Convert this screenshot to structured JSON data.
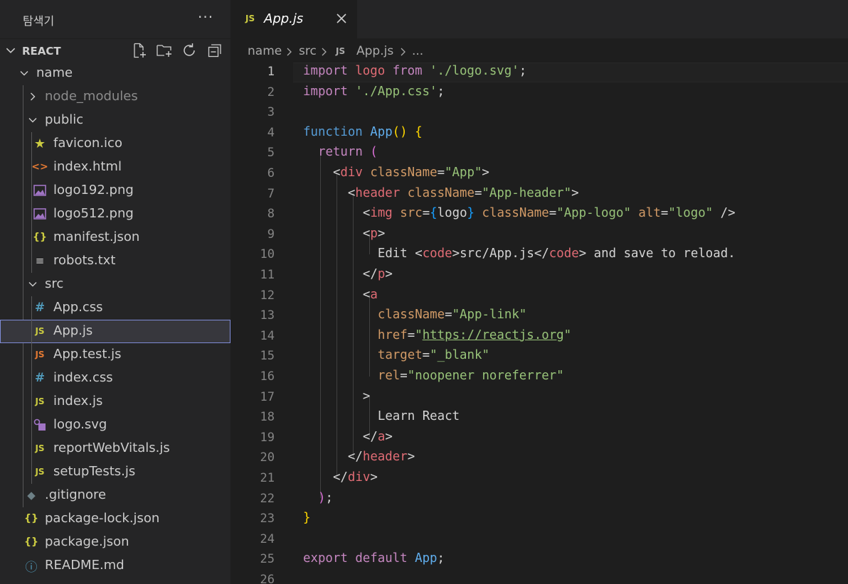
{
  "sidebar": {
    "title": "탐색기",
    "more": "···",
    "section_title": "REACT",
    "actions": [
      "new-file",
      "new-folder",
      "refresh",
      "collapse-all"
    ],
    "items": [
      {
        "label": "name",
        "type": "folder",
        "expanded": true
      },
      {
        "label": "node_modules",
        "type": "folder",
        "expanded": false
      },
      {
        "label": "public",
        "type": "folder",
        "expanded": true
      },
      {
        "label": "favicon.ico",
        "icon": "star"
      },
      {
        "label": "index.html",
        "icon": "<>"
      },
      {
        "label": "logo192.png",
        "icon": "image"
      },
      {
        "label": "logo512.png",
        "icon": "image"
      },
      {
        "label": "manifest.json",
        "icon": "{}"
      },
      {
        "label": "robots.txt",
        "icon": "≡"
      },
      {
        "label": "src",
        "type": "folder",
        "expanded": true
      },
      {
        "label": "App.css",
        "icon": "#"
      },
      {
        "label": "App.js",
        "icon": "JS",
        "selected": true
      },
      {
        "label": "App.test.js",
        "icon": "JS"
      },
      {
        "label": "index.css",
        "icon": "#"
      },
      {
        "label": "index.js",
        "icon": "JS"
      },
      {
        "label": "logo.svg",
        "icon": "svg"
      },
      {
        "label": "reportWebVitals.js",
        "icon": "JS"
      },
      {
        "label": "setupTests.js",
        "icon": "JS"
      },
      {
        "label": ".gitignore",
        "icon": "git"
      },
      {
        "label": "package-lock.json",
        "icon": "{}"
      },
      {
        "label": "package.json",
        "icon": "{}"
      },
      {
        "label": "README.md",
        "icon": "ⓘ"
      }
    ]
  },
  "tab": {
    "icon": "JS",
    "label": "App.js"
  },
  "breadcrumb": {
    "parts": [
      "name",
      "src",
      "App.js",
      "..."
    ],
    "file_icon": "JS"
  },
  "editor": {
    "line_numbers": [
      "1",
      "2",
      "3",
      "4",
      "5",
      "6",
      "7",
      "8",
      "9",
      "10",
      "11",
      "12",
      "13",
      "14",
      "15",
      "16",
      "17",
      "18",
      "19",
      "20",
      "21",
      "22",
      "23",
      "24",
      "25",
      "26"
    ],
    "active_line": "1",
    "lines": [
      "import logo from './logo.svg';",
      "import './App.css';",
      "",
      "function App() {",
      "  return (",
      "    <div className=\"App\">",
      "      <header className=\"App-header\">",
      "        <img src={logo} className=\"App-logo\" alt=\"logo\" />",
      "        <p>",
      "          Edit <code>src/App.js</code> and save to reload.",
      "        </p>",
      "        <a",
      "          className=\"App-link\"",
      "          href=\"https://reactjs.org\"",
      "          target=\"_blank\"",
      "          rel=\"noopener noreferrer\"",
      "        >",
      "          Learn React",
      "        </a>",
      "      </header>",
      "    </div>",
      "  );",
      "}",
      "",
      "export default App;",
      ""
    ]
  },
  "colors": {
    "keyword": "#c586c0",
    "function_keyword": "#569cd6",
    "string": "#98c379",
    "tag": "#e06c75",
    "attribute": "#d19a66",
    "selection_border": "#7e8bd6"
  }
}
